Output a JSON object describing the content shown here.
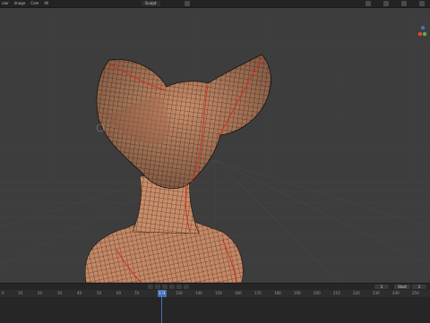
{
  "menus": [
    "ular",
    "Image",
    "Com",
    "All"
  ],
  "mode": "Sculpt",
  "timeline": {
    "current_frame": "121",
    "current_frame_label": "120",
    "start": "1",
    "end_label": "Start",
    "end": "1",
    "ticks": [
      "0",
      "10",
      "20",
      "30",
      "40",
      "50",
      "60",
      "70",
      "80",
      "90",
      "100",
      "110",
      "120",
      "130",
      "140",
      "150",
      "160",
      "170",
      "180",
      "190",
      "200",
      "210",
      "220",
      "230",
      "240",
      "250"
    ]
  },
  "colors": {
    "viewport": "#3d3d3d",
    "grid": "#474747",
    "skin": "#c98d6a",
    "wire": "#2a1a12",
    "seam": "#d32b1f",
    "accent": "#4772b3"
  },
  "icons": [
    "overlay-icon",
    "shading-solid-icon",
    "shading-material-icon",
    "shading-render-icon",
    "navigation-gizmo-icon"
  ]
}
